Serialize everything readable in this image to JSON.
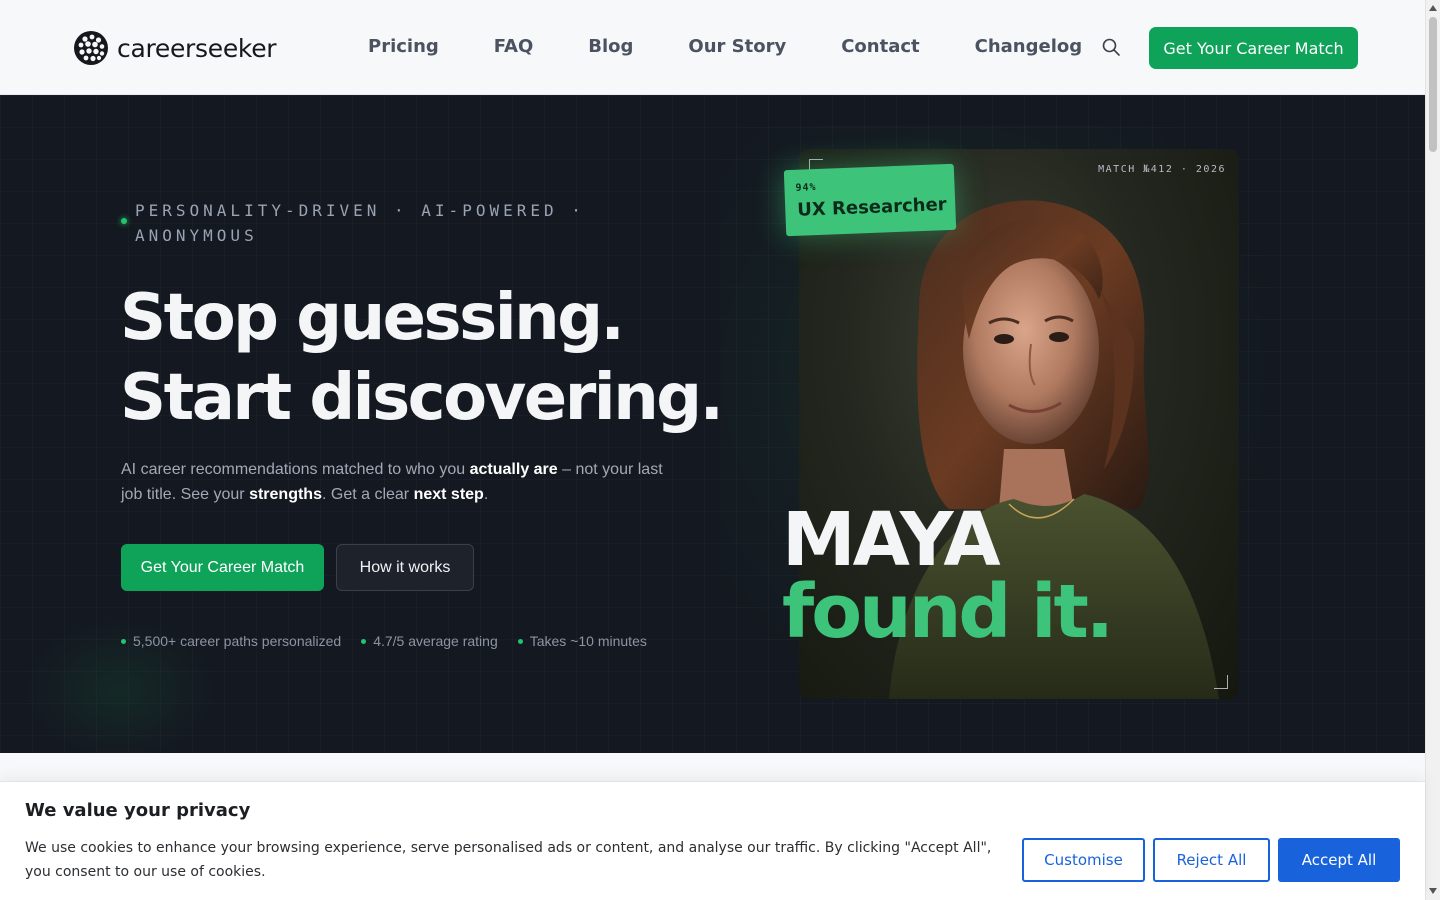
{
  "header": {
    "logo_text": "careerseeker",
    "nav": [
      "Pricing",
      "FAQ",
      "Blog",
      "Our Story",
      "Contact",
      "Changelog"
    ],
    "cta_label": "Get Your Career Match"
  },
  "hero": {
    "eyebrow": "PERSONALITY-DRIVEN · AI-POWERED · ANONYMOUS",
    "headline_line1": "Stop guessing.",
    "headline_line2": "Start discovering.",
    "sub_1": "AI career recommendations matched to who you ",
    "sub_b1": "actually are",
    "sub_2": " – not your last job title. See your ",
    "sub_b2": "strengths",
    "sub_3": ". Get a clear ",
    "sub_b3": "next step",
    "sub_4": ".",
    "primary_button": "Get Your Career Match",
    "secondary_button": "How it works",
    "stats": [
      "5,500+ career paths personalized",
      "4.7/5 average rating",
      "Takes ~10 minutes"
    ]
  },
  "portrait": {
    "match_code": "MATCH №412 · 2026",
    "badge_percent": "94%",
    "badge_role": "UX Researcher",
    "name_line": "MAYA",
    "found_line": "found it."
  },
  "cookie": {
    "title": "We value your privacy",
    "text": "We use cookies to enhance your browsing experience, serve personalised ads or content, and analyse our traffic. By clicking \"Accept All\", you consent to our use of cookies.",
    "customise": "Customise",
    "reject": "Reject All",
    "accept": "Accept All"
  },
  "colors": {
    "brand_green": "#0fa35a",
    "accent_green": "#3ec47a",
    "hero_bg": "#141820",
    "cookie_blue": "#1863dc"
  },
  "icons": {
    "search": "search-icon",
    "logo": "logo-icon"
  }
}
